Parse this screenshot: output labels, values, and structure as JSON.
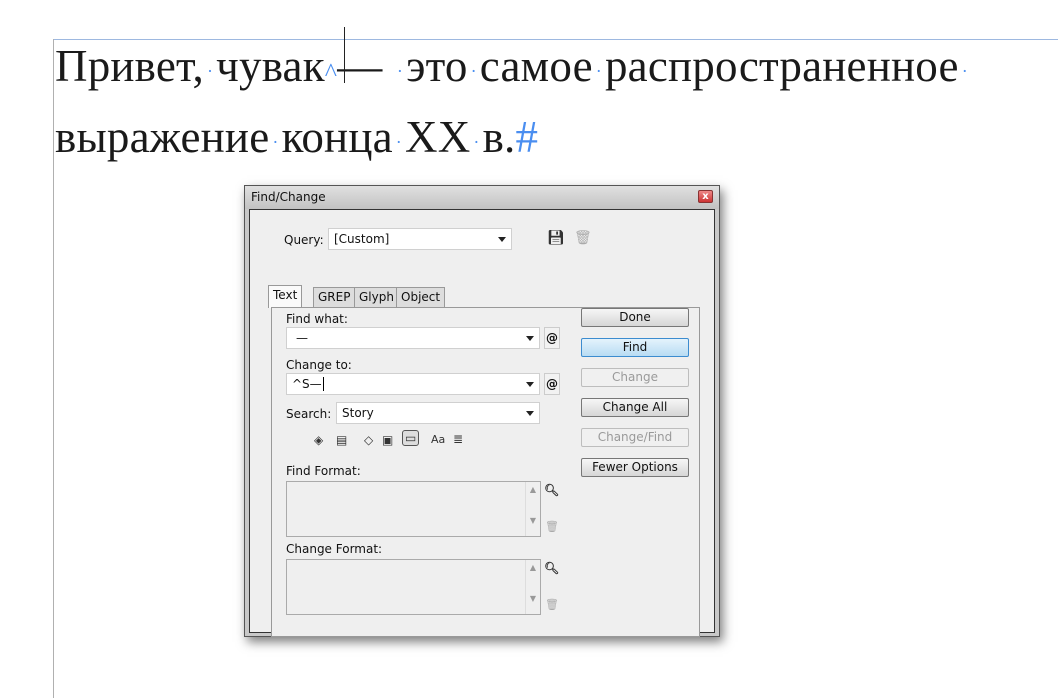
{
  "document": {
    "line1_words": [
      "Привет,",
      "чувак",
      "— ",
      "это",
      "самое",
      "распространенное"
    ],
    "line2_words": [
      "выражение",
      "конца",
      "XX",
      "в."
    ],
    "end_mark": "#",
    "caret_mark": "^",
    "space_marker": "·"
  },
  "dialog": {
    "title": "Find/Change",
    "close_label": "x",
    "query_label": "Query:",
    "query_value": "[Custom]",
    "tabs": [
      "Text",
      "GREP",
      "Glyph",
      "Object"
    ],
    "find_what_label": "Find what:",
    "find_what_value": "—",
    "change_to_label": "Change to:",
    "change_to_value": "^S—",
    "special_char_label": "@",
    "search_label": "Search:",
    "search_value": "Story",
    "option_icons": [
      "Aa",
      "≣"
    ],
    "find_format_label": "Find Format:",
    "change_format_label": "Change Format:",
    "buttons": {
      "done": "Done",
      "find": "Find",
      "change": "Change",
      "change_all": "Change All",
      "change_find": "Change/Find",
      "fewer_options": "Fewer Options"
    }
  }
}
